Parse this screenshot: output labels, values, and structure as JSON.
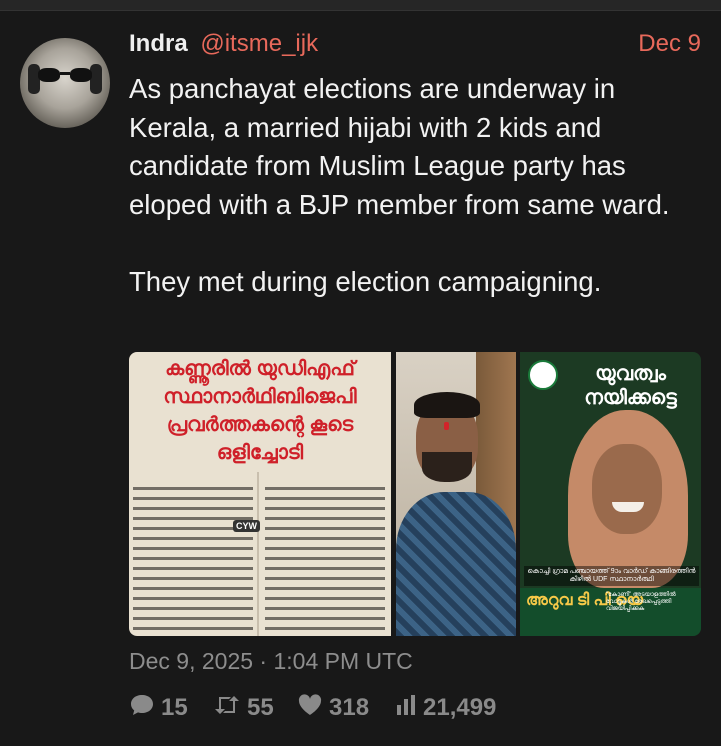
{
  "post": {
    "author_name": "Indra",
    "author_handle": "@itsme_ijk",
    "date": "Dec 9",
    "text": "As panchayat elections are underway in Kerala, a married hijabi with 2 kids and candidate from Muslim League party has eloped with a BJP member from same ward.\n\nThey met during election campaigning.",
    "timestamp": "Dec 9, 2025 · 1:04 PM UTC"
  },
  "media": {
    "newspaper_heading": [
      "കണ്ണൂരിൽ യുഡിഎഫ്",
      "സ്ഥാനാർഥിബിജെപി",
      "പ്രവർത്തകന്റെ കൂടെ",
      "ഒളിച്ചോടി"
    ],
    "newspaper_mark": "CYW",
    "poster_title": "യുവത്വം നയിക്കട്ടെ",
    "poster_caption": "കൊച്ചി ഗ്രാമ പഞ്ചായത്ത് 9ാം വാർഡ് കാങ്ങിരത്തിൻ കിഴിൽ UDF സ്ഥാനാർത്ഥി",
    "poster_name": "അറുവ ടി പി യെ",
    "poster_slogan": "\"കോണി\" അടയാളത്തിൽ വോട്ടുകൾ രേഖപ്പെടുത്തി വിജയിപ്പിക്കുക"
  },
  "stats": {
    "replies": "15",
    "reposts": "55",
    "likes": "318",
    "views": "21,499"
  },
  "colors": {
    "accent": "#e8695b",
    "background": "#181818"
  }
}
